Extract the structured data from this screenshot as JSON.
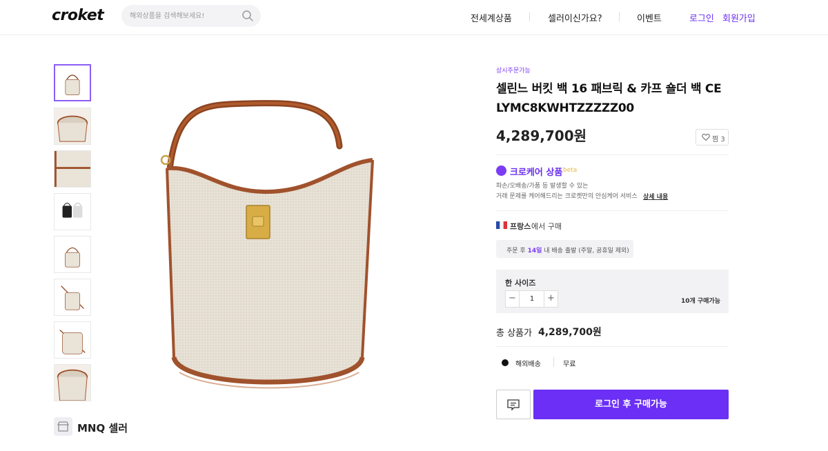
{
  "header": {
    "logo": "croket",
    "search_placeholder": "해외상품을 검색해보세요!",
    "nav": [
      "전세계상품",
      "셀러이신가요?",
      "이벤트"
    ],
    "login": "로그인",
    "signup": "회원가입"
  },
  "thumbnails": [
    "thumb-1",
    "thumb-2",
    "thumb-3",
    "thumb-4",
    "thumb-5",
    "thumb-6",
    "thumb-7",
    "thumb-8"
  ],
  "seller": {
    "name": "MNQ 셀러"
  },
  "product": {
    "badge": "상시주문가능",
    "title": "셀린느 버킷 백 16 패브릭 & 카프 숄더 백 CE LYMC8KWHTZZZZZ00",
    "price": "4,289,700원",
    "like_label": "찜 3"
  },
  "care": {
    "title": "크로케어 상품",
    "beta": "beta",
    "desc_line1": "파손/오배송/가품 등 발생할 수 있는",
    "desc_line2": "거래 문제를 케어해드리는 크로켓만의 안심케어 서비스",
    "link": "상세 내용"
  },
  "origin": {
    "country": "프랑스",
    "suffix": "에서 구매",
    "ship_prefix": "주문 후",
    "ship_days": "14일",
    "ship_suffix": "내 배송 출발 (주말, 공휴일 제외)"
  },
  "option": {
    "label": "한 사이즈",
    "minus": "−",
    "qty": "1",
    "plus": "+",
    "stock": "10개 구매가능"
  },
  "total": {
    "label": "총 상품가",
    "value": "4,289,700원"
  },
  "shipping": {
    "method": "해외배송",
    "fee": "무료"
  },
  "actions": {
    "buy_label": "로그인 후 구매가능"
  },
  "colors": {
    "accent": "#6b2ff5",
    "brand_text": "#111111",
    "beta": "#e5b64a"
  }
}
